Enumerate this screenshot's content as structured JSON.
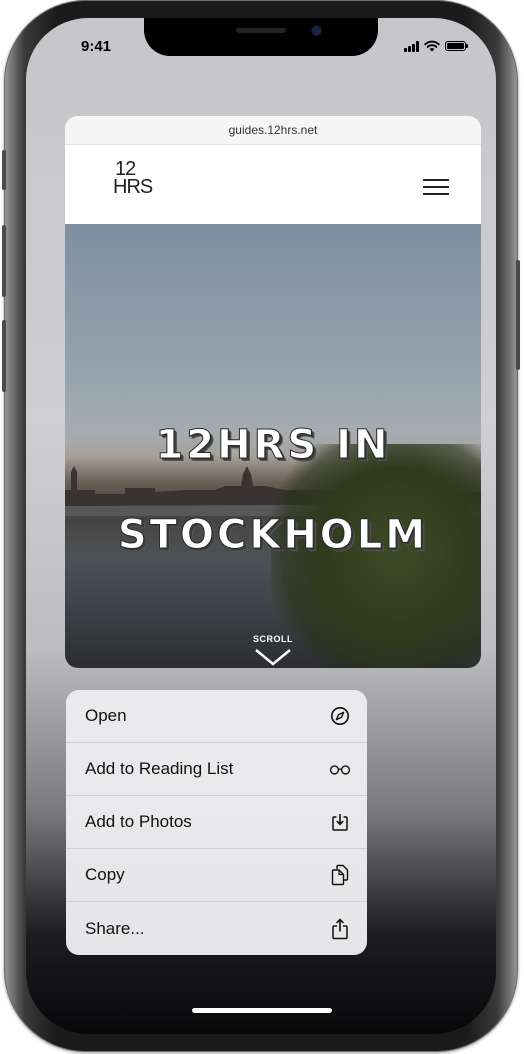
{
  "status_bar": {
    "time": "9:41"
  },
  "browser": {
    "url": "guides.12hrs.net"
  },
  "site": {
    "logo_line1": "12",
    "logo_line2": "HRS"
  },
  "hero": {
    "title_line1": "12HRS IN",
    "title_line2": "STOCKHOLM",
    "scroll_label": "SCROLL"
  },
  "context_menu": {
    "items": [
      {
        "label": "Open",
        "icon": "compass-icon"
      },
      {
        "label": "Add to Reading List",
        "icon": "glasses-icon"
      },
      {
        "label": "Add to Photos",
        "icon": "download-tray-icon"
      },
      {
        "label": "Copy",
        "icon": "copy-icon"
      },
      {
        "label": "Share...",
        "icon": "share-icon"
      }
    ]
  },
  "colors": {
    "menu_background": "#ececee",
    "text": "#111111",
    "hero_sky": "#8b9aa8"
  }
}
